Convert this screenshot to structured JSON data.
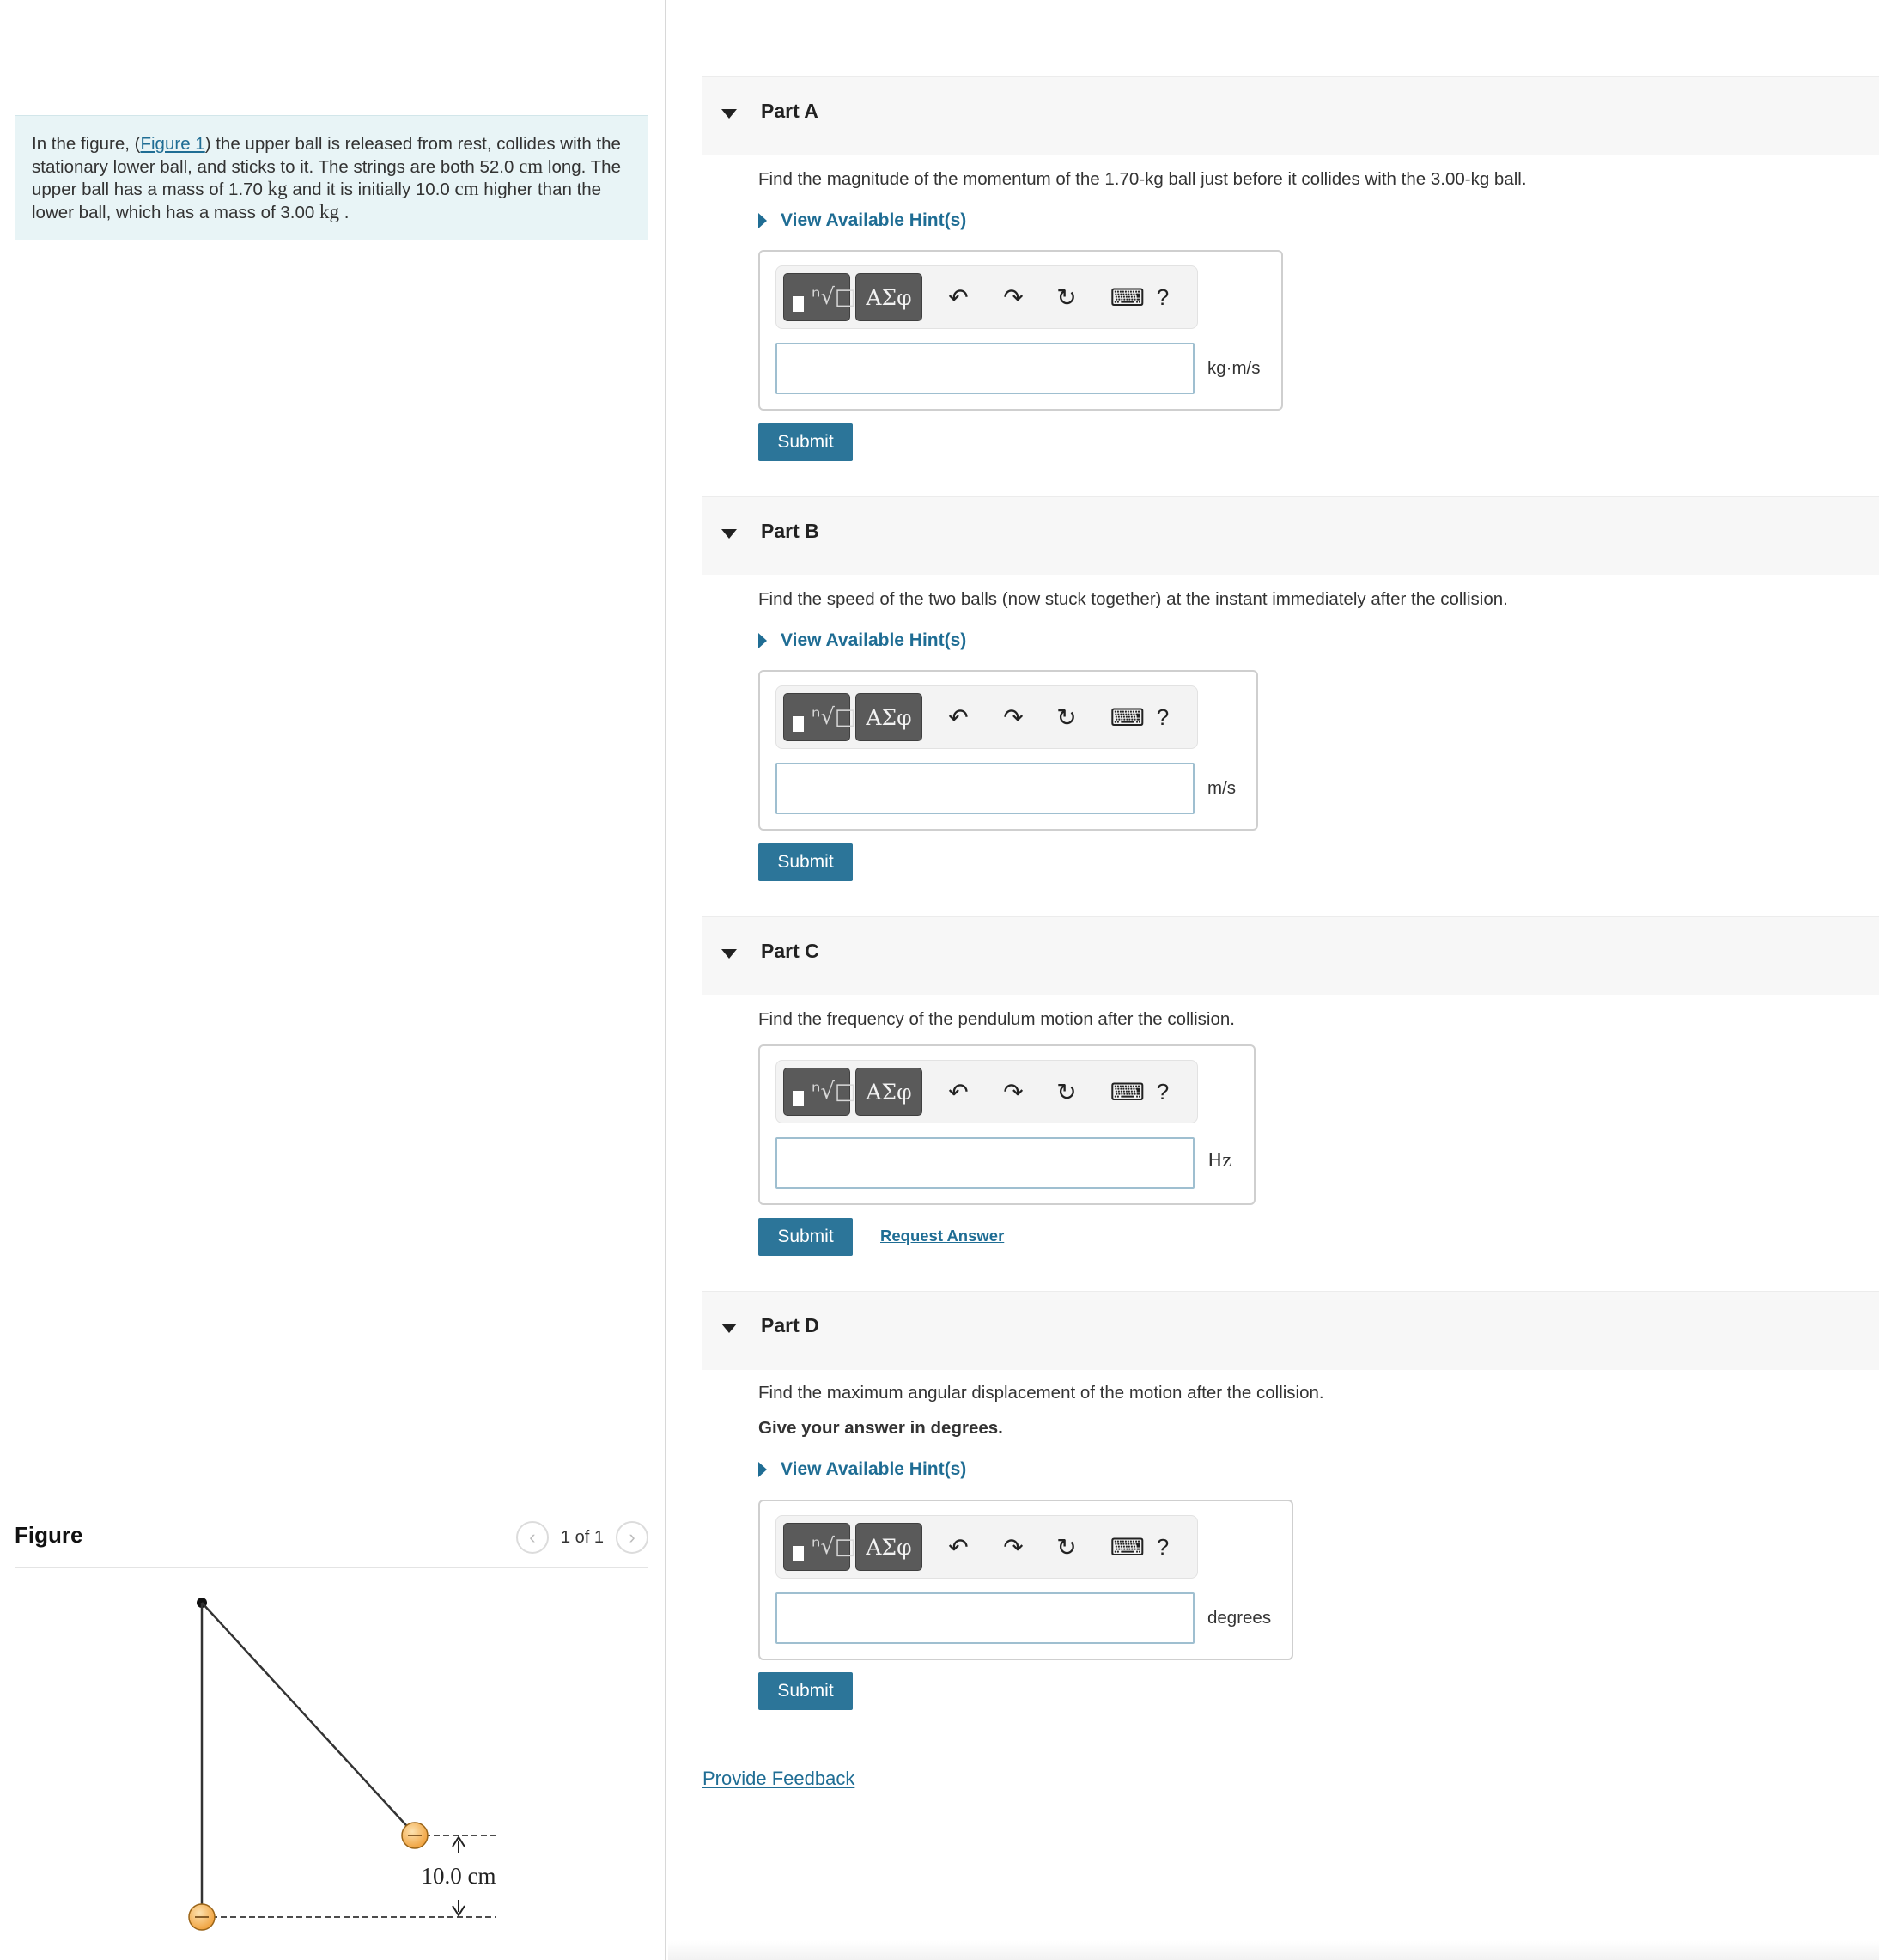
{
  "problem": {
    "intro": "In the figure, (",
    "figure_link": "Figure 1",
    "t1": ") the upper ball is released from rest, collides with the stationary lower ball, and sticks to it. The strings are both 52.0 ",
    "u1": "cm",
    "t2": " long. The upper ball has a mass of 1.70 ",
    "u2": "kg",
    "t3": " and it is initially 10.0 ",
    "u3": "cm",
    "t4": " higher than the lower ball, which has a mass of 3.00 ",
    "u4": "kg",
    "t5": " ."
  },
  "figure": {
    "title": "Figure",
    "pager": "1 of 1",
    "prev_icon": "chevron-left-icon",
    "next_icon": "chevron-right-icon",
    "height_label": "10.0 cm"
  },
  "toolbar": {
    "greek_label": "ΑΣφ",
    "templates_glyph": "ⁿ√□",
    "help_label": "?",
    "icons": [
      "templates-icon",
      "greek-icon",
      "undo-icon",
      "redo-icon",
      "reset-icon",
      "keyboard-icon",
      "help-icon"
    ]
  },
  "parts": [
    {
      "title": "Part A",
      "question": "Find the magnitude of the momentum of the 1.70-kg ball just before it collides with the 3.00-kg ball.",
      "hint": "View Available Hint(s)",
      "unit": "kg·m/s",
      "submit": "Submit"
    },
    {
      "title": "Part B",
      "question": "Find the speed of the two balls (now stuck together) at the instant immediately after the collision.",
      "hint": "View Available Hint(s)",
      "unit": "m/s",
      "submit": "Submit"
    },
    {
      "title": "Part C",
      "question": "Find the frequency of the pendulum motion after the collision.",
      "unit": "Hz",
      "submit": "Submit",
      "request_answer": "Request Answer"
    },
    {
      "title": "Part D",
      "question": "Find the maximum angular displacement of the motion after the collision.",
      "instruction": "Give your answer in degrees.",
      "hint": "View Available Hint(s)",
      "unit": "degrees",
      "submit": "Submit"
    }
  ],
  "feedback_link": "Provide Feedback",
  "colors": {
    "accent": "#2c7599",
    "link": "#1f6d94",
    "problem_bg": "#e8f4f6",
    "part_header_bg": "#f7f7f7",
    "ball": "#f5b25a"
  }
}
